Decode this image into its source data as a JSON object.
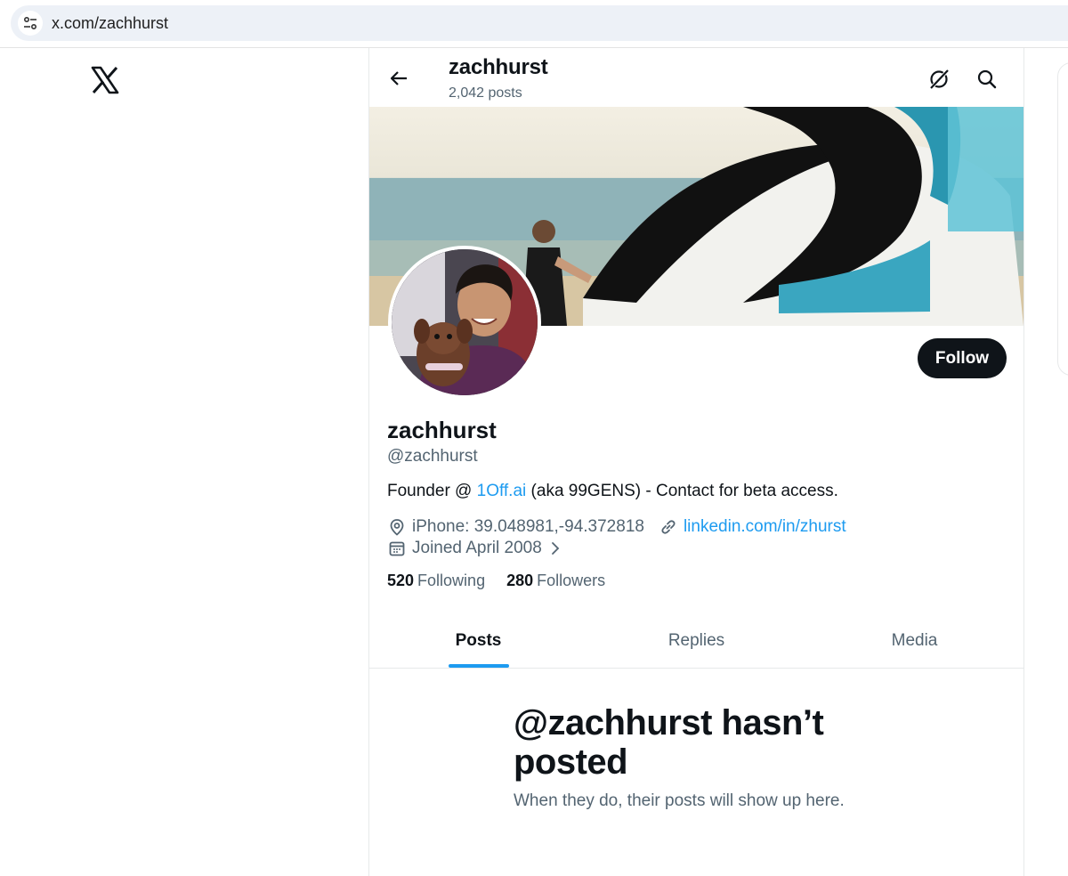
{
  "browser": {
    "url": "x.com/zachhurst",
    "icons": {
      "site_settings": "tune-icon"
    }
  },
  "app": {
    "logo": "x-logo"
  },
  "header": {
    "title": "zachhurst",
    "post_count": "2,042 posts",
    "icons": {
      "back": "arrow-left-icon",
      "grok": "grok-icon",
      "search": "search-icon"
    }
  },
  "profile": {
    "follow_label": "Follow",
    "display_name": "zachhurst",
    "handle": "@zachhurst",
    "bio": {
      "prefix": "Founder @ ",
      "mention": "1Off.ai",
      "suffix": " (aka 99GENS) - Contact for beta access."
    },
    "location": "iPhone: 39.048981,-94.372818",
    "website": "linkedin.com/in/zhurst",
    "joined": "Joined April 2008",
    "following_count": "520",
    "following_label": "Following",
    "followers_count": "280",
    "followers_label": "Followers",
    "icons": {
      "location": "map-pin-icon",
      "link": "link-icon",
      "calendar": "calendar-icon",
      "chevron": "chevron-right-icon"
    }
  },
  "tabs": [
    {
      "label": "Posts",
      "active": true
    },
    {
      "label": "Replies",
      "active": false
    },
    {
      "label": "Media",
      "active": false
    }
  ],
  "empty_state": {
    "title": "@zachhurst hasn’t posted",
    "subtitle": "When they do, their posts will show up here."
  },
  "colors": {
    "accent": "#1d9bf0",
    "text_primary": "#0f1419",
    "text_secondary": "#536471",
    "button_bg": "#0f1419"
  }
}
